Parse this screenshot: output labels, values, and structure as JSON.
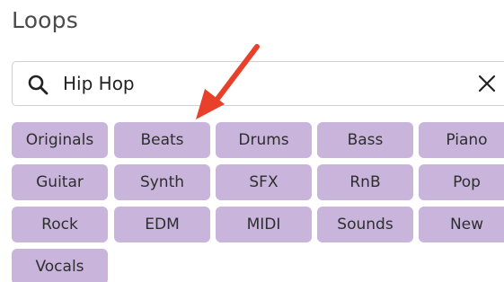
{
  "panel": {
    "title": "Loops"
  },
  "search": {
    "value": "Hip Hop",
    "icon": "search-icon",
    "clear_icon": "close-icon"
  },
  "categories": [
    "Originals",
    "Beats",
    "Drums",
    "Bass",
    "Piano",
    "Guitar",
    "Synth",
    "SFX",
    "RnB",
    "Pop",
    "Rock",
    "EDM",
    "MIDI",
    "Sounds",
    "New",
    "Vocals"
  ],
  "colors": {
    "chip_bg": "#c9b4dc",
    "annotation_arrow": "#e8402a",
    "title_text": "#4a4a4a"
  }
}
